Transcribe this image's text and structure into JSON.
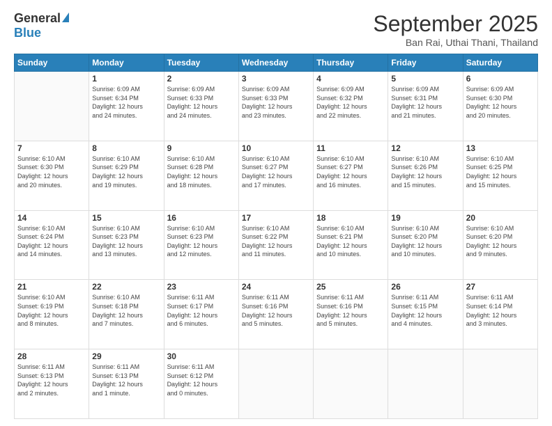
{
  "logo": {
    "general": "General",
    "blue": "Blue"
  },
  "header": {
    "month": "September 2025",
    "location": "Ban Rai, Uthai Thani, Thailand"
  },
  "weekdays": [
    "Sunday",
    "Monday",
    "Tuesday",
    "Wednesday",
    "Thursday",
    "Friday",
    "Saturday"
  ],
  "weeks": [
    [
      {
        "day": "",
        "info": ""
      },
      {
        "day": "1",
        "info": "Sunrise: 6:09 AM\nSunset: 6:34 PM\nDaylight: 12 hours\nand 24 minutes."
      },
      {
        "day": "2",
        "info": "Sunrise: 6:09 AM\nSunset: 6:33 PM\nDaylight: 12 hours\nand 24 minutes."
      },
      {
        "day": "3",
        "info": "Sunrise: 6:09 AM\nSunset: 6:33 PM\nDaylight: 12 hours\nand 23 minutes."
      },
      {
        "day": "4",
        "info": "Sunrise: 6:09 AM\nSunset: 6:32 PM\nDaylight: 12 hours\nand 22 minutes."
      },
      {
        "day": "5",
        "info": "Sunrise: 6:09 AM\nSunset: 6:31 PM\nDaylight: 12 hours\nand 21 minutes."
      },
      {
        "day": "6",
        "info": "Sunrise: 6:09 AM\nSunset: 6:30 PM\nDaylight: 12 hours\nand 20 minutes."
      }
    ],
    [
      {
        "day": "7",
        "info": "Sunrise: 6:10 AM\nSunset: 6:30 PM\nDaylight: 12 hours\nand 20 minutes."
      },
      {
        "day": "8",
        "info": "Sunrise: 6:10 AM\nSunset: 6:29 PM\nDaylight: 12 hours\nand 19 minutes."
      },
      {
        "day": "9",
        "info": "Sunrise: 6:10 AM\nSunset: 6:28 PM\nDaylight: 12 hours\nand 18 minutes."
      },
      {
        "day": "10",
        "info": "Sunrise: 6:10 AM\nSunset: 6:27 PM\nDaylight: 12 hours\nand 17 minutes."
      },
      {
        "day": "11",
        "info": "Sunrise: 6:10 AM\nSunset: 6:27 PM\nDaylight: 12 hours\nand 16 minutes."
      },
      {
        "day": "12",
        "info": "Sunrise: 6:10 AM\nSunset: 6:26 PM\nDaylight: 12 hours\nand 15 minutes."
      },
      {
        "day": "13",
        "info": "Sunrise: 6:10 AM\nSunset: 6:25 PM\nDaylight: 12 hours\nand 15 minutes."
      }
    ],
    [
      {
        "day": "14",
        "info": "Sunrise: 6:10 AM\nSunset: 6:24 PM\nDaylight: 12 hours\nand 14 minutes."
      },
      {
        "day": "15",
        "info": "Sunrise: 6:10 AM\nSunset: 6:23 PM\nDaylight: 12 hours\nand 13 minutes."
      },
      {
        "day": "16",
        "info": "Sunrise: 6:10 AM\nSunset: 6:23 PM\nDaylight: 12 hours\nand 12 minutes."
      },
      {
        "day": "17",
        "info": "Sunrise: 6:10 AM\nSunset: 6:22 PM\nDaylight: 12 hours\nand 11 minutes."
      },
      {
        "day": "18",
        "info": "Sunrise: 6:10 AM\nSunset: 6:21 PM\nDaylight: 12 hours\nand 10 minutes."
      },
      {
        "day": "19",
        "info": "Sunrise: 6:10 AM\nSunset: 6:20 PM\nDaylight: 12 hours\nand 10 minutes."
      },
      {
        "day": "20",
        "info": "Sunrise: 6:10 AM\nSunset: 6:20 PM\nDaylight: 12 hours\nand 9 minutes."
      }
    ],
    [
      {
        "day": "21",
        "info": "Sunrise: 6:10 AM\nSunset: 6:19 PM\nDaylight: 12 hours\nand 8 minutes."
      },
      {
        "day": "22",
        "info": "Sunrise: 6:10 AM\nSunset: 6:18 PM\nDaylight: 12 hours\nand 7 minutes."
      },
      {
        "day": "23",
        "info": "Sunrise: 6:11 AM\nSunset: 6:17 PM\nDaylight: 12 hours\nand 6 minutes."
      },
      {
        "day": "24",
        "info": "Sunrise: 6:11 AM\nSunset: 6:16 PM\nDaylight: 12 hours\nand 5 minutes."
      },
      {
        "day": "25",
        "info": "Sunrise: 6:11 AM\nSunset: 6:16 PM\nDaylight: 12 hours\nand 5 minutes."
      },
      {
        "day": "26",
        "info": "Sunrise: 6:11 AM\nSunset: 6:15 PM\nDaylight: 12 hours\nand 4 minutes."
      },
      {
        "day": "27",
        "info": "Sunrise: 6:11 AM\nSunset: 6:14 PM\nDaylight: 12 hours\nand 3 minutes."
      }
    ],
    [
      {
        "day": "28",
        "info": "Sunrise: 6:11 AM\nSunset: 6:13 PM\nDaylight: 12 hours\nand 2 minutes."
      },
      {
        "day": "29",
        "info": "Sunrise: 6:11 AM\nSunset: 6:13 PM\nDaylight: 12 hours\nand 1 minute."
      },
      {
        "day": "30",
        "info": "Sunrise: 6:11 AM\nSunset: 6:12 PM\nDaylight: 12 hours\nand 0 minutes."
      },
      {
        "day": "",
        "info": ""
      },
      {
        "day": "",
        "info": ""
      },
      {
        "day": "",
        "info": ""
      },
      {
        "day": "",
        "info": ""
      }
    ]
  ]
}
